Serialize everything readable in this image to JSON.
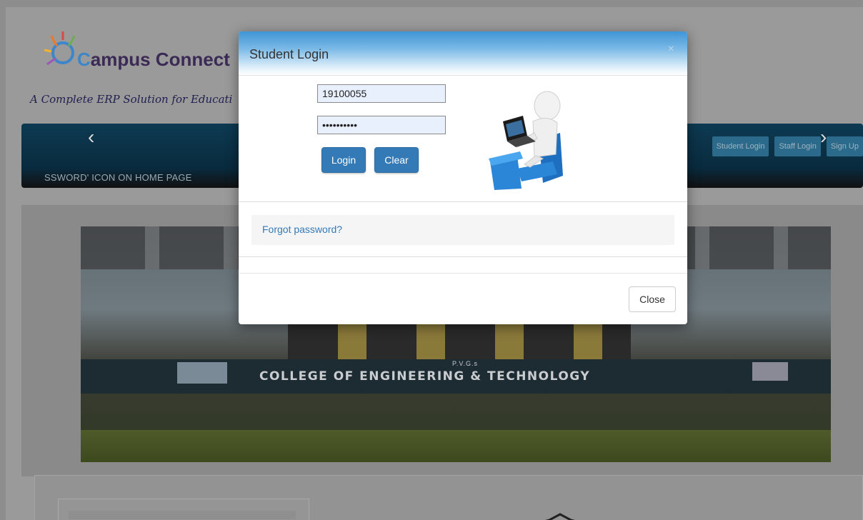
{
  "site": {
    "logo_text": "ampus Connect",
    "logo_initial": "C",
    "tagline": "A Complete ERP Solution for Educati",
    "marquee": "SSWORD' ICON ON HOME PAGE",
    "nav_links": [
      {
        "label": "Student Login"
      },
      {
        "label": "Staff Login"
      },
      {
        "label": "Sign Up"
      }
    ],
    "carousel": {
      "college_prefix": "P.V.G.s",
      "college_name": "COLLEGE OF ENGINEERING & TECHNOLOGY",
      "prev": "‹",
      "next": "›"
    }
  },
  "modal": {
    "title": "Student Login",
    "close_x": "×",
    "username_value": "19100055",
    "password_value": "••••••••••",
    "login_label": "Login",
    "clear_label": "Clear",
    "forgot_label": "Forgot password?",
    "close_label": "Close"
  },
  "colors": {
    "accent": "#337ab7",
    "navbar": "#0d3a52",
    "nav_link": "#2b6a8b"
  }
}
